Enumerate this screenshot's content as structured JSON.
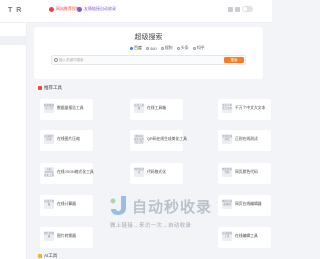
{
  "header": {
    "logo": "T R",
    "notices": [
      "网站推荐投稿",
      "友情链接自动收录"
    ]
  },
  "search": {
    "title": "超级搜索",
    "tabs": [
      "百度",
      "360",
      "搜狗",
      "头条",
      "知乎"
    ],
    "active_tab": "百度",
    "placeholder": "输入关键词搜索",
    "button_label": "搜索"
  },
  "sections": {
    "primary": "推荐工具",
    "secondary": "AI工具"
  },
  "cards": [
    {
      "name": "数据量报告工具",
      "thumb": "数据量报告工具"
    },
    {
      "name": "在线工具箱",
      "thumb": "在线工具箱"
    },
    {
      "name": "千万个中文大文本",
      "thumb": "千万个中文大文本"
    },
    {
      "name": "在线图片压缩",
      "thumb": "在线图片压缩"
    },
    {
      "name": "QR码在线生成美化工具",
      "thumb": "QR码在线生成美化工具"
    },
    {
      "name": "正则在线测试",
      "thumb": "正则在线测试"
    },
    {
      "name": "在线JSON格式化工具",
      "thumb": "在线JSON格式化工具"
    },
    {
      "name": "代码格式化",
      "thumb": "代码格式化"
    },
    {
      "name": "网页颜色代码",
      "thumb": "网页颜色代码"
    },
    {
      "name": "在线计算器",
      "thumb": "在线计算器"
    },
    {
      "name": "网页在线编辑器",
      "thumb": "网页在线编辑器"
    },
    {
      "name": "图片转换器",
      "thumb": "图片转换器"
    },
    {
      "name": "在线编辑工具",
      "thumb": "在线编辑工具"
    }
  ],
  "watermark": {
    "brand": "自动秒收录",
    "tagline": "做上链接→来访一次→自动收录"
  },
  "colors": {
    "accent": "#3d7cf4",
    "search_button": "#ff7a1f",
    "notice_red": "#e8453c",
    "notice_purple": "#7e5bd6"
  }
}
